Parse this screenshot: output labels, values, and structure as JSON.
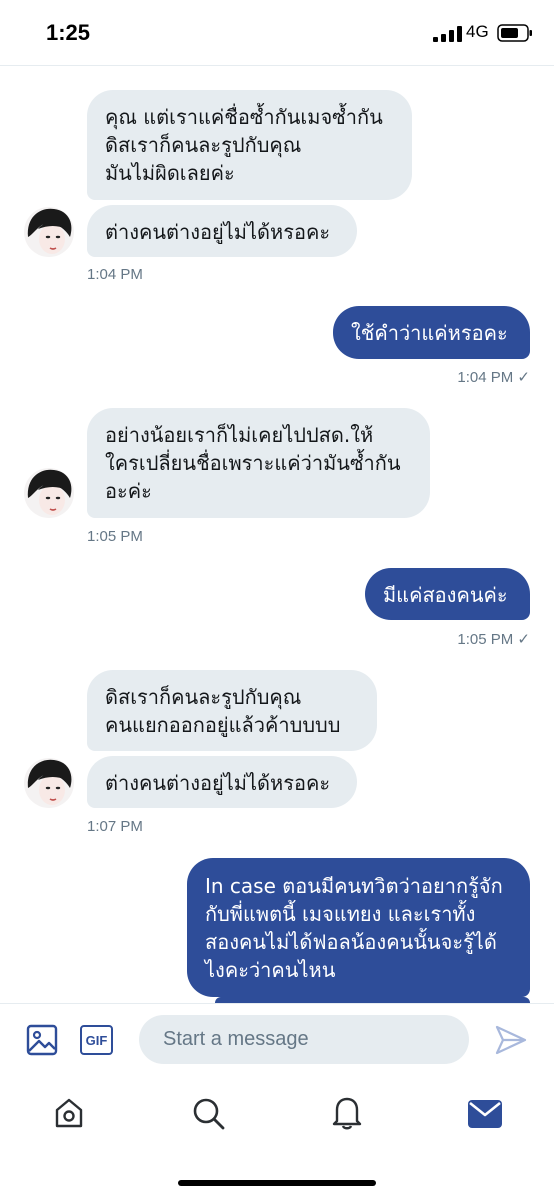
{
  "status_bar": {
    "time": "1:25",
    "network": "4G"
  },
  "messages": {
    "in1_a": "คุณ แต่เราแค่ชื่อซ้ำกันเมจซ้ำกัน\nดิสเราก็คนละรูปกับคุณ\nมันไม่ผิดเลยค่ะ",
    "in1_b": "ต่างคนต่างอยู่ไม่ได้หรอคะ",
    "in1_time": "1:04 PM",
    "out1": "ใช้คำว่าแค่หรอคะ",
    "out1_time": "1:04 PM ✓",
    "in2": "อย่างน้อยเราก็ไม่เคยไปปสด.ให้\nใครเปลี่ยนชื่อเพราะแค่ว่ามันซ้ำกัน\nอะค่ะ",
    "in2_time": "1:05 PM",
    "out2": "มีแค่สองคนค่ะ",
    "out2_time": "1:05 PM ✓",
    "in3_a": "ดิสเราก็คนละรูปกับคุณ\nคนแยกออกอยู่แล้วค้าบบบบ",
    "in3_b": "ต่างคนต่างอยู่ไม่ได้หรอคะ",
    "in3_time": "1:07 PM",
    "out3": "In case ตอนมีคนทวิตว่าอยากรู้จัก\nกับพี่แพตนี้ เมจแทยง และเราทั้ง\nสองคนไม่ได้ฟอลน้องคนนั้นจะรู้ได้\nไงคะว่าคนไหน"
  },
  "composer": {
    "placeholder": "Start a message",
    "gif_label": "GIF"
  },
  "colors": {
    "outgoing_bubble": "#2e4d99",
    "incoming_bubble": "#e6ecf0",
    "accent": "#2e4d99"
  }
}
